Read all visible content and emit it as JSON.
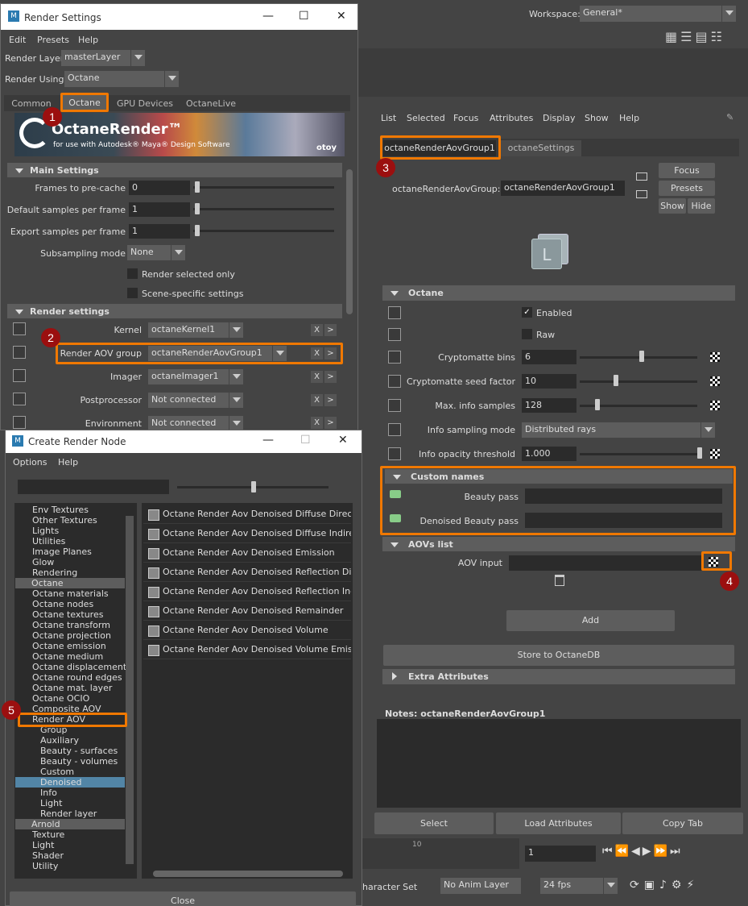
{
  "maya": {
    "workspace_label": "Workspace:",
    "workspace_value": "General*"
  },
  "render_settings": {
    "title": "Render Settings",
    "menu": [
      "Edit",
      "Presets",
      "Help"
    ],
    "render_layer_label": "Render Layer",
    "render_layer_value": "masterLayer",
    "render_using_label": "Render Using",
    "render_using_value": "Octane",
    "tabs": [
      "Common",
      "Octane",
      "GPU Devices",
      "OctaneLive"
    ],
    "banner_title": "OctaneRender™",
    "banner_subtitle": "for use with Autodesk® Maya® Design Software",
    "banner_brand": "otoy",
    "main_settings": "Main Settings",
    "frames_label": "Frames to pre-cache",
    "frames_value": "0",
    "default_samples_label": "Default samples per frame",
    "default_samples_value": "1",
    "export_samples_label": "Export samples per frame",
    "export_samples_value": "1",
    "subsampling_label": "Subsampling mode",
    "subsampling_value": "None",
    "render_selected_only": "Render selected only",
    "scene_specific": "Scene-specific settings",
    "render_settings_section": "Render settings",
    "kernel_label": "Kernel",
    "kernel_value": "octaneKernel1",
    "aov_label": "Render AOV group",
    "aov_value": "octaneRenderAovGroup1",
    "imager_label": "Imager",
    "imager_value": "octaneImager1",
    "post_label": "Postprocessor",
    "post_value": "Not connected",
    "env_label": "Environment",
    "env_value": "Not connected",
    "x": "X",
    "gt": ">"
  },
  "attr_editor": {
    "menu": [
      "List",
      "Selected",
      "Focus",
      "Attributes",
      "Display",
      "Show",
      "Help"
    ],
    "tab_active": "octaneRenderAovGroup1",
    "tab_other": "octaneSettings",
    "node_label": "octaneRenderAovGroup:",
    "node_value": "octaneRenderAovGroup1",
    "focus": "Focus",
    "presets": "Presets",
    "show": "Show",
    "hide": "Hide",
    "octane_section": "Octane",
    "enabled": "Enabled",
    "raw": "Raw",
    "crypto_bins_label": "Cryptomatte bins",
    "crypto_bins_value": "6",
    "crypto_seed_label": "Cryptomatte seed factor",
    "crypto_seed_value": "10",
    "max_info_label": "Max. info samples",
    "max_info_value": "128",
    "info_mode_label": "Info sampling mode",
    "info_mode_value": "Distributed rays",
    "info_opacity_label": "Info opacity threshold",
    "info_opacity_value": "1.000",
    "custom_names": "Custom names",
    "beauty_pass": "Beauty pass",
    "denoised_beauty_pass": "Denoised Beauty pass",
    "aovs_list": "AOVs list",
    "aov_input": "AOV input",
    "add": "Add",
    "store": "Store to OctaneDB",
    "extra": "Extra Attributes",
    "notes_label": "Notes:  octaneRenderAovGroup1",
    "select": "Select",
    "load": "Load Attributes",
    "copy": "Copy Tab"
  },
  "timeline": {
    "tick": "10",
    "frame": "1",
    "character_set": "haracter Set",
    "anim_layer": "No Anim Layer",
    "fps": "24 fps"
  },
  "create_node": {
    "title": "Create Render Node",
    "menu": [
      "Options",
      "Help"
    ],
    "tree": [
      {
        "label": "Env Textures",
        "indent": 1
      },
      {
        "label": "Other Textures",
        "indent": 1
      },
      {
        "label": "Lights",
        "indent": 1
      },
      {
        "label": "Utilities",
        "indent": 1
      },
      {
        "label": "Image Planes",
        "indent": 1
      },
      {
        "label": "Glow",
        "indent": 1
      },
      {
        "label": "Rendering",
        "indent": 1
      },
      {
        "label": "Octane",
        "indent": 0
      },
      {
        "label": "Octane materials",
        "indent": 1
      },
      {
        "label": "Octane nodes",
        "indent": 1
      },
      {
        "label": "Octane textures",
        "indent": 1
      },
      {
        "label": "Octane transform",
        "indent": 1
      },
      {
        "label": "Octane projection",
        "indent": 1
      },
      {
        "label": "Octane emission",
        "indent": 1
      },
      {
        "label": "Octane medium",
        "indent": 1
      },
      {
        "label": "Octane displacement",
        "indent": 1
      },
      {
        "label": "Octane round edges",
        "indent": 1
      },
      {
        "label": "Octane mat. layer",
        "indent": 1
      },
      {
        "label": "Octane OCIO",
        "indent": 1
      },
      {
        "label": "Composite AOV",
        "indent": 1
      },
      {
        "label": "Render AOV",
        "indent": 1
      },
      {
        "label": "Group",
        "indent": 2
      },
      {
        "label": "Auxiliary",
        "indent": 2
      },
      {
        "label": "Beauty - surfaces",
        "indent": 2
      },
      {
        "label": "Beauty - volumes",
        "indent": 2
      },
      {
        "label": "Custom",
        "indent": 2
      },
      {
        "label": "Denoised",
        "indent": 2
      },
      {
        "label": "Info",
        "indent": 2
      },
      {
        "label": "Light",
        "indent": 2
      },
      {
        "label": "Render layer",
        "indent": 2
      },
      {
        "label": "Arnold",
        "indent": 0
      },
      {
        "label": "Texture",
        "indent": 1
      },
      {
        "label": "Light",
        "indent": 1
      },
      {
        "label": "Shader",
        "indent": 1
      },
      {
        "label": "Utility",
        "indent": 1
      }
    ],
    "nodes": [
      "Octane Render Aov Denoised Diffuse Direct",
      "Octane Render Aov Denoised Diffuse Indirect",
      "Octane Render Aov Denoised Emission",
      "Octane Render Aov Denoised Reflection Direct",
      "Octane Render Aov Denoised Reflection Indirect",
      "Octane Render Aov Denoised Remainder",
      "Octane Render Aov Denoised Volume",
      "Octane Render Aov Denoised Volume Emission"
    ],
    "close": "Close"
  },
  "badges": [
    "1",
    "2",
    "3",
    "4",
    "5"
  ]
}
